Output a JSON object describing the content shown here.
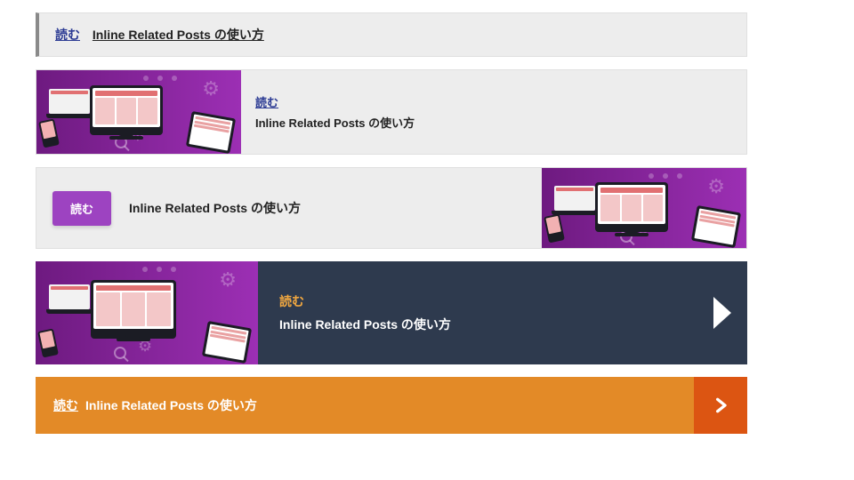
{
  "read_label": "読む",
  "post_title": "Inline Related Posts の使い方",
  "colors": {
    "link_blue": "#2b3a93",
    "purple_btn": "#9d43c1",
    "slate": "#2e3a4e",
    "accent_orange": "#f2a840",
    "orange_bg": "#e38a27",
    "orange_chevron_bg": "#dc5512"
  },
  "cards": [
    {
      "style": "minimal-link"
    },
    {
      "style": "thumb-left-grey"
    },
    {
      "style": "purple-button-thumb-right"
    },
    {
      "style": "thumb-left-dark-arrow"
    },
    {
      "style": "orange-bar-chevron"
    }
  ]
}
